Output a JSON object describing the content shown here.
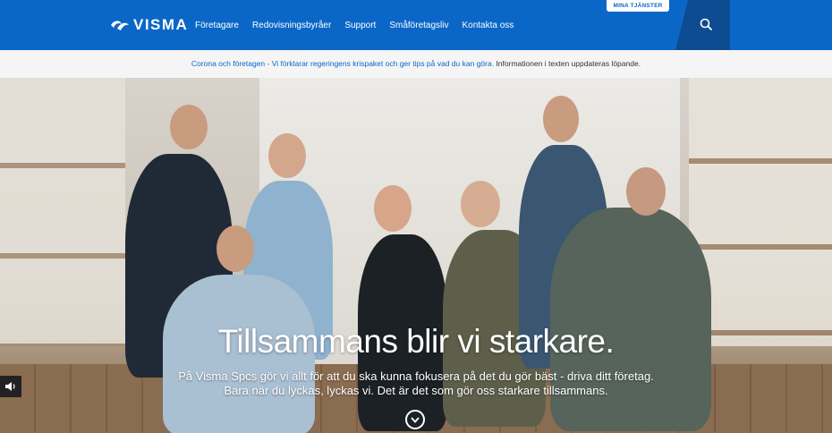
{
  "header": {
    "logo_text": "VISMA",
    "nav": [
      "Företagare",
      "Redovisningsbyråer",
      "Support",
      "Småföretagsliv",
      "Kontakta oss"
    ],
    "mina_tjanster": "MINA TJÄNSTER",
    "brand_color": "#0b67c7"
  },
  "infobar": {
    "link_text": "Corona och företagen - Vi förklarar regeringens krispaket och ger tips på vad du kan göra.",
    "note": " Informationen i texten uppdateras löpande."
  },
  "hero": {
    "title": "Tillsammans blir vi starkare.",
    "line1": "På Visma Spcs gör vi allt för att du ska kunna fokusera på det du gör bäst - driva ditt företag.",
    "line2": "Bara när du lyckas, lyckas vi. Det är det som gör oss starkare tillsammans."
  },
  "icons": {
    "search": "search-icon",
    "scroll_down": "chevron-down-icon",
    "audio": "speaker-icon"
  }
}
